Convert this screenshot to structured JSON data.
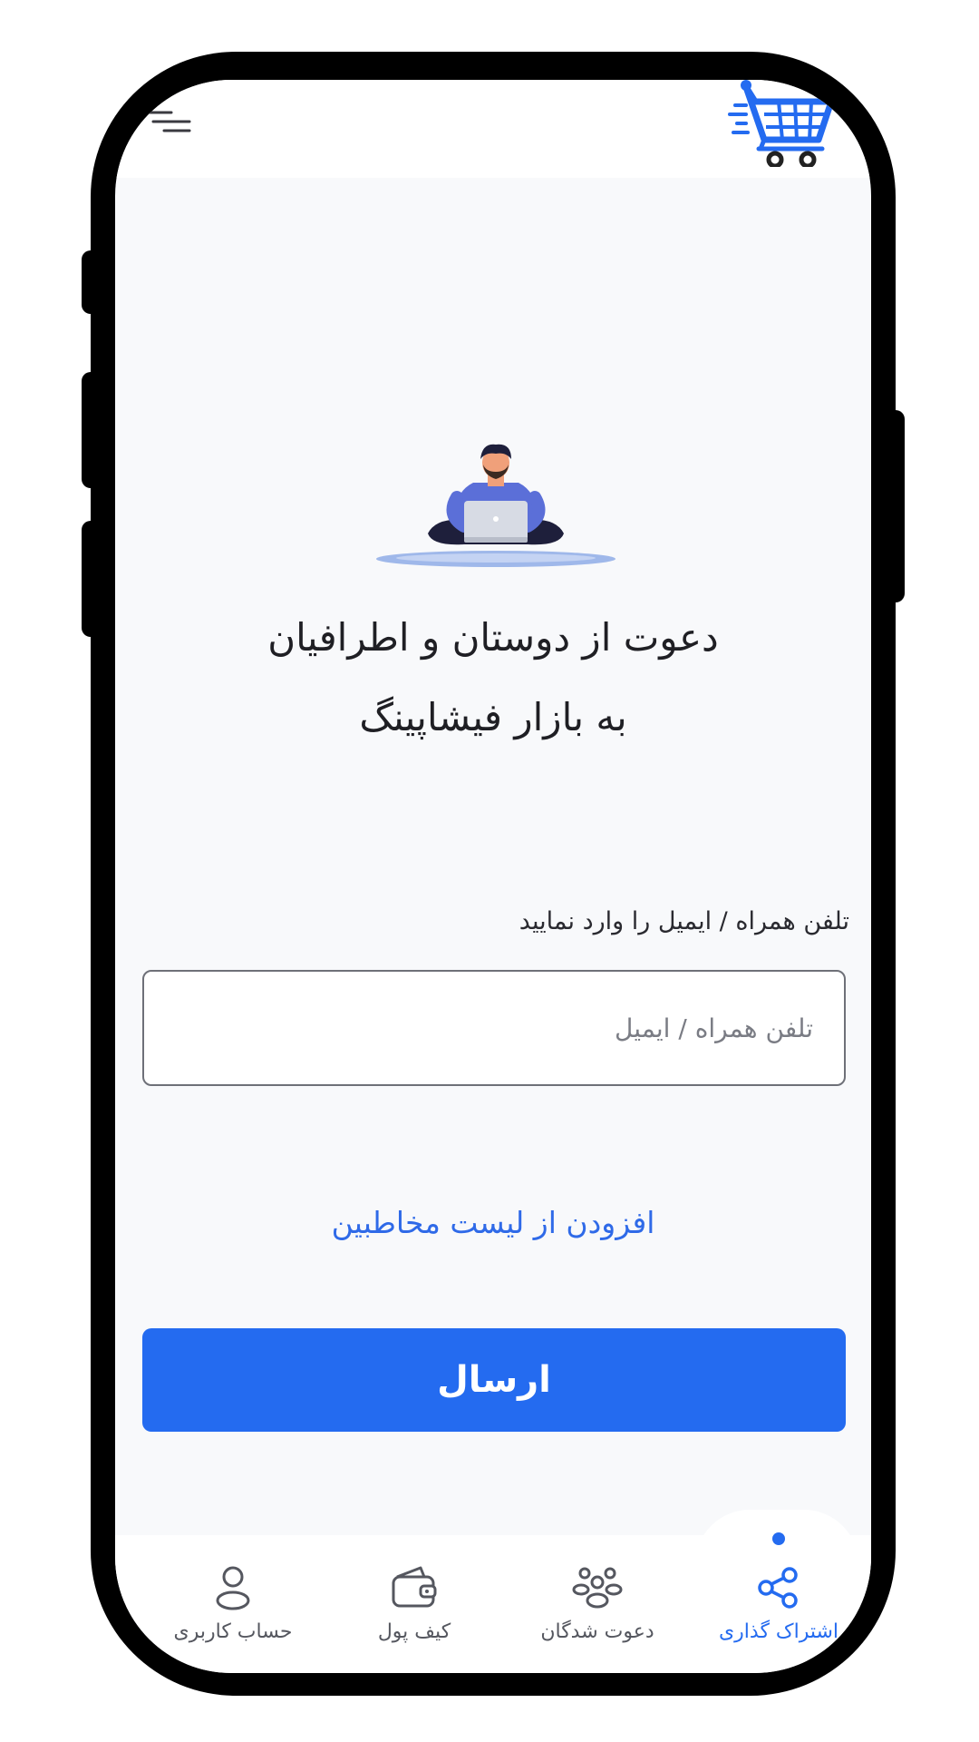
{
  "header": {
    "menu_icon": "menu-icon",
    "logo_icon": "cart-icon",
    "logo_color": "#246bf0"
  },
  "hero": {
    "illustration": "person-with-laptop",
    "title_line1": "دعوت از دوستان و اطرافیان",
    "title_line2": "به بازار فیشاپینگ"
  },
  "form": {
    "label": "تلفن همراه / ایمیل را وارد نمایید",
    "placeholder": "تلفن همراه / ایمیل",
    "value": "",
    "add_contacts_link": "افزودن از لیست مخاطبین",
    "submit_label": "ارسال"
  },
  "bottom_nav": {
    "items": [
      {
        "label": "اشتراک گذاری",
        "icon": "share-icon",
        "active": true
      },
      {
        "label": "دعوت شدگان",
        "icon": "users-icon",
        "active": false
      },
      {
        "label": "کیف پول",
        "icon": "wallet-icon",
        "active": false
      },
      {
        "label": "حساب کاربری",
        "icon": "user-icon",
        "active": false
      }
    ]
  },
  "colors": {
    "primary": "#246bf0",
    "background": "#f8f9fb",
    "text": "#1f1f24"
  }
}
